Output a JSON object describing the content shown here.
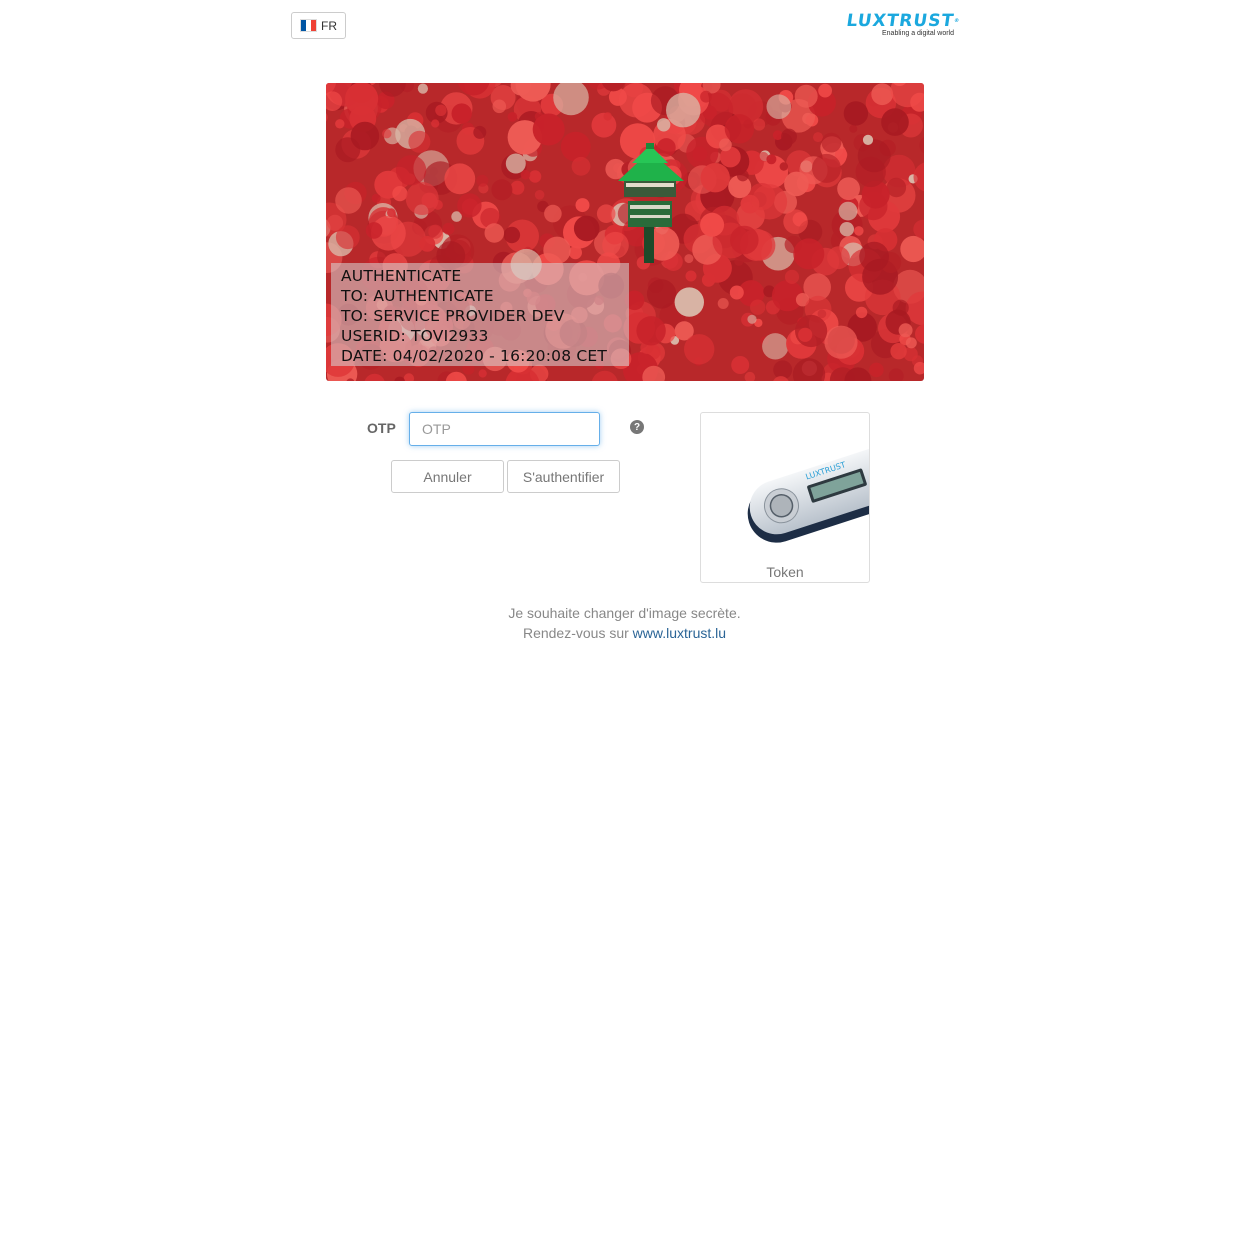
{
  "header": {
    "language_label": "FR",
    "flag_colors": [
      "#0055A4",
      "#FFFFFF",
      "#EF4135"
    ],
    "logo": {
      "brand": "LUXTRUST",
      "tm": "®",
      "tagline": "Enabling a digital world",
      "color": "#1ba8de"
    }
  },
  "secret_image": {
    "description_icon": "forest-tower-image",
    "caption_lines": [
      "AUTHENTICATE",
      "TO: AUTHENTICATE",
      "TO: SERVICE PROVIDER DEV",
      "USERID: TOVI2933",
      "DATE: 04/02/2020 - 16:20:08 CET"
    ]
  },
  "form": {
    "otp_label": "OTP",
    "otp_placeholder": "OTP",
    "otp_value": "",
    "help_icon": "question-circle-icon",
    "help_glyph": "?",
    "cancel_label": "Annuler",
    "submit_label": "S'authentifier"
  },
  "token": {
    "label": "Token",
    "device_brand": "LUXTRUST"
  },
  "footer": {
    "line1": "Je souhaite changer d'image secrète.",
    "line2_prefix": "Rendez-vous sur",
    "link_text": "www.luxtrust.lu"
  }
}
